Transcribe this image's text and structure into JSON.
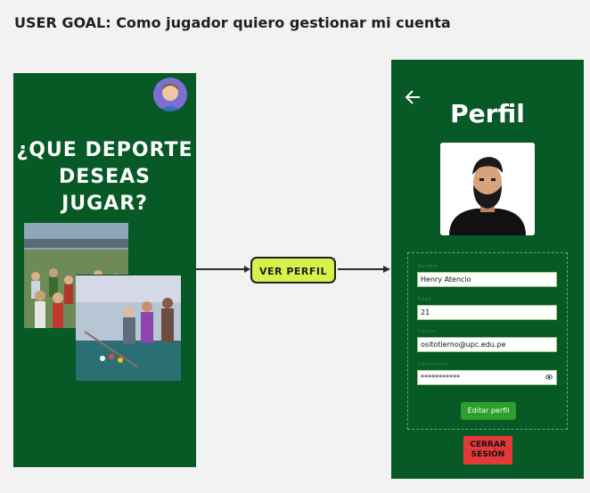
{
  "header": {
    "goal": "USER GOAL: Como jugador quiero gestionar mi cuenta"
  },
  "left_screen": {
    "title_line1": "¿QUE DEPORTE",
    "title_line2": "DESEAS JUGAR?",
    "avatar_icon": "user-avatar"
  },
  "flow": {
    "ver_perfil_label": "VER PERFIL"
  },
  "right_screen": {
    "back_icon": "arrow-left-icon",
    "title": "Perfil",
    "fields": [
      {
        "label": "Nombre",
        "value": "Henry Atencio"
      },
      {
        "label": "Edad",
        "value": "21"
      },
      {
        "label": "Correo",
        "value": "ositotierno@upc.edu.pe"
      },
      {
        "label": "Contraseña",
        "value": "***********"
      }
    ],
    "edit_label": "Editar perfil",
    "logout_line1": "CERRAR",
    "logout_line2": "SESIÓN"
  },
  "colors": {
    "screen_bg": "#075925",
    "accent_button": "#d7f04a",
    "edit_button": "#2ca02c",
    "logout_button": "#e5383b"
  }
}
